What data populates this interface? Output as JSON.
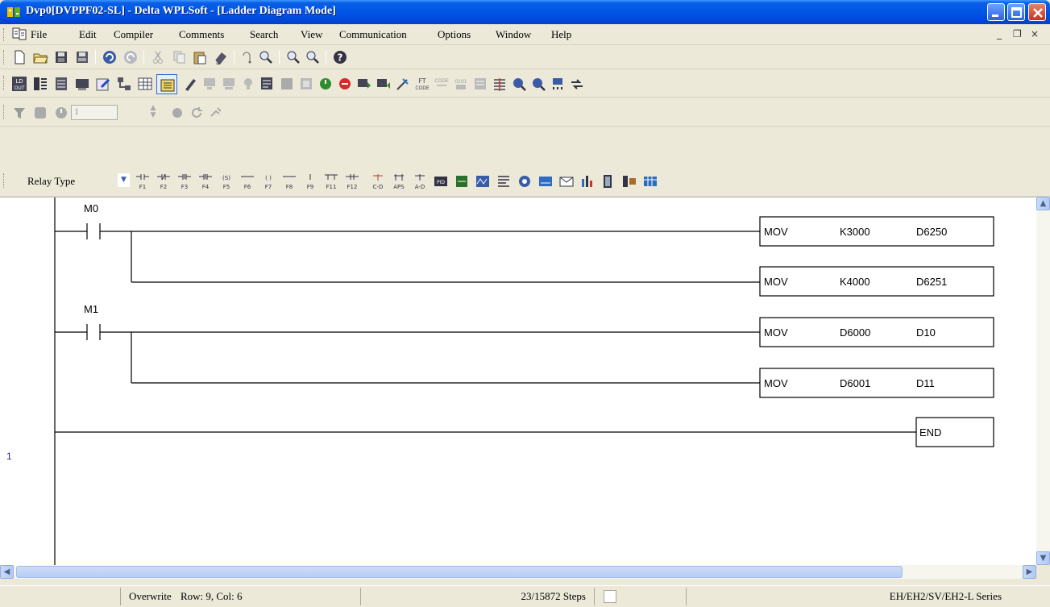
{
  "window": {
    "title": "Dvp0[DVPPF02-SL] - Delta WPLSoft - [Ladder Diagram Mode]",
    "controls": [
      "minimize",
      "maximize",
      "close"
    ]
  },
  "menubar": {
    "items": [
      "File",
      "Edit",
      "Compiler",
      "Comments",
      "Search",
      "View",
      "Communication",
      "Options",
      "Window",
      "Help"
    ],
    "mdi_controls": [
      "_",
      "❐",
      "×"
    ]
  },
  "toolbar_monitor": {
    "step_value": "1"
  },
  "toolbar_relay": {
    "relay_type_label": "Relay Type"
  },
  "ladder": {
    "rows": [
      {
        "contact": "M0",
        "instruction": "MOV",
        "op1": "K3000",
        "op2": "D6250"
      },
      {
        "contact": "",
        "instruction": "MOV",
        "op1": "K4000",
        "op2": "D6251"
      },
      {
        "contact": "M1",
        "instruction": "MOV",
        "op1": "D6000",
        "op2": "D10"
      },
      {
        "contact": "",
        "instruction": "MOV",
        "op1": "D6001",
        "op2": "D11"
      }
    ],
    "end_label": "END",
    "line_number": "1"
  },
  "statusbar": {
    "mode": "Overwrite",
    "position": "Row: 9, Col: 6",
    "steps": "23/15872 Steps",
    "series": "EH/EH2/SV/EH2-L Series"
  }
}
